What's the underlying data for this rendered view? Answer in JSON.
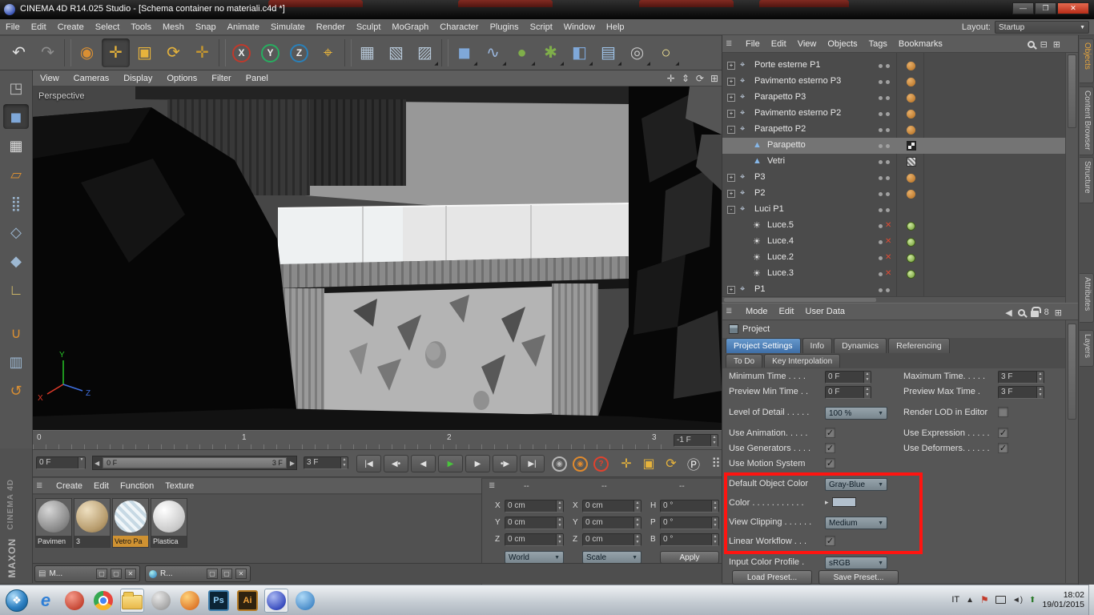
{
  "window": {
    "title": "CINEMA 4D R14.025 Studio - [Schema container no materiali.c4d *]",
    "controls": {
      "minimize": "—",
      "maximize": "❐",
      "close": "✕"
    }
  },
  "background_tabs": {
    "count": 4
  },
  "menu_bar": {
    "items": [
      "File",
      "Edit",
      "Create",
      "Select",
      "Tools",
      "Mesh",
      "Snap",
      "Animate",
      "Simulate",
      "Render",
      "Sculpt",
      "MoGraph",
      "Character",
      "Plugins",
      "Script",
      "Window",
      "Help"
    ],
    "layout_label": "Layout:",
    "layout_value": "Startup"
  },
  "toolbar": {
    "buttons": [
      {
        "name": "undo",
        "glyph": "↶",
        "color": "#e2e2e2"
      },
      {
        "name": "redo",
        "glyph": "↷",
        "color": "#8f8f8f"
      },
      {
        "sep": true
      },
      {
        "name": "live-selection",
        "glyph": "◉",
        "color": "#d98f33"
      },
      {
        "name": "move-tool",
        "glyph": "✛",
        "color": "#e6b33c",
        "pressed": true
      },
      {
        "name": "scale-tool",
        "glyph": "▣",
        "color": "#e6b33c"
      },
      {
        "name": "rotate-tool",
        "glyph": "⟳",
        "color": "#e6b33c"
      },
      {
        "name": "last-used-tool",
        "glyph": "✛",
        "color": "#c9992e"
      },
      {
        "sep": true
      },
      {
        "name": "lock-x-axis",
        "glyph": "X",
        "color": "#efefef",
        "ring": "#c0392b"
      },
      {
        "name": "lock-y-axis",
        "glyph": "Y",
        "color": "#efefef",
        "ring": "#27ae60"
      },
      {
        "name": "lock-z-axis",
        "glyph": "Z",
        "color": "#efefef",
        "ring": "#2980b9"
      },
      {
        "name": "coordinate-system",
        "glyph": "⌖",
        "color": "#e6b33c"
      },
      {
        "sep": true
      },
      {
        "name": "render-view",
        "glyph": "▦",
        "color": "#b5c6d6"
      },
      {
        "name": "render-region",
        "glyph": "▧",
        "color": "#b5c6d6"
      },
      {
        "name": "render-settings",
        "glyph": "▨",
        "color": "#b5c6d6",
        "arrow": true
      },
      {
        "sep": true
      },
      {
        "name": "add-cube",
        "glyph": "◼",
        "color": "#7fa8d9",
        "arrow": true
      },
      {
        "name": "add-spline",
        "glyph": "∿",
        "color": "#9ab6dd",
        "arrow": true
      },
      {
        "name": "add-generator",
        "glyph": "●",
        "color": "#7fae4a",
        "arrow": true
      },
      {
        "name": "add-mograph",
        "glyph": "✱",
        "color": "#7fae4a",
        "arrow": true
      },
      {
        "name": "add-deformer",
        "glyph": "◧",
        "color": "#7fa8d9",
        "arrow": true
      },
      {
        "name": "add-environment",
        "glyph": "▤",
        "color": "#9fc3e8",
        "arrow": true
      },
      {
        "name": "add-camera",
        "glyph": "◎",
        "color": "#c4c4c4",
        "arrow": true
      },
      {
        "name": "add-light",
        "glyph": "○",
        "color": "#f2e394",
        "arrow": true
      }
    ]
  },
  "left_toolbar": {
    "buttons": [
      {
        "name": "make-editable",
        "glyph": "◳",
        "color": "#bdbdbd"
      },
      {
        "name": "model-mode",
        "glyph": "◼",
        "color": "#7fa8d9",
        "pressed": true
      },
      {
        "name": "texture-mode",
        "glyph": "▦",
        "color": "#dcdcdc"
      },
      {
        "name": "texture-axis-mode",
        "glyph": "▱",
        "color": "#d98f33"
      },
      {
        "name": "points-mode",
        "glyph": "⣿",
        "color": "#9db8d2"
      },
      {
        "name": "edges-mode",
        "glyph": "◇",
        "color": "#9db8d2"
      },
      {
        "name": "polygons-mode",
        "glyph": "◆",
        "color": "#9db8d2"
      },
      {
        "name": "axis-mode",
        "glyph": "∟",
        "color": "#d9c06a"
      },
      {
        "name": "snap-toggle",
        "glyph": "∪",
        "color": "#d98f33",
        "gap": true
      },
      {
        "name": "lock-workplane",
        "glyph": "▥",
        "color": "#9db8d2"
      },
      {
        "name": "workplane-tool",
        "glyph": "↺",
        "color": "#d98f33"
      }
    ]
  },
  "viewport": {
    "menus": [
      "View",
      "Cameras",
      "Display",
      "Options",
      "Filter",
      "Panel"
    ],
    "corner_icons": [
      {
        "name": "pan-view-icon",
        "glyph": "✛"
      },
      {
        "name": "zoom-view-icon",
        "glyph": "⇕"
      },
      {
        "name": "rotate-view-icon",
        "glyph": "⟳"
      },
      {
        "name": "toggle-layout-icon",
        "glyph": "⊞"
      }
    ],
    "label": "Perspective",
    "axis_labels": {
      "x": "X",
      "y": "Y",
      "z": "Z"
    }
  },
  "timeline": {
    "ticks": [
      "0",
      "1",
      "2",
      "3"
    ],
    "end_field": "-1 F"
  },
  "transport": {
    "current_frame": "0 F",
    "range_start": "0 F",
    "range_end": "3 F",
    "frame_field": "3 F",
    "buttons": [
      {
        "name": "goto-start",
        "glyph": "|◀"
      },
      {
        "name": "prev-key",
        "glyph": "◀•"
      },
      {
        "name": "prev-frame",
        "glyph": "◀"
      },
      {
        "name": "play",
        "glyph": "▶",
        "color": "#49c53c"
      },
      {
        "name": "next-frame",
        "glyph": "▶"
      },
      {
        "name": "next-key",
        "glyph": "•▶"
      },
      {
        "name": "goto-end",
        "glyph": "▶|"
      }
    ],
    "record_buttons": [
      {
        "name": "record-button",
        "glyph": "◉",
        "color": "#b8b8b8"
      },
      {
        "name": "autokey-button",
        "glyph": "◉",
        "color": "#e08a2e"
      },
      {
        "name": "help-button",
        "glyph": "?",
        "color": "#e0422e"
      }
    ],
    "right_buttons": [
      {
        "name": "move-icon",
        "glyph": "✛",
        "color": "#e6b33c"
      },
      {
        "name": "scale-icon",
        "glyph": "▣",
        "color": "#e6b33c"
      },
      {
        "name": "rotate-icon",
        "glyph": "⟳",
        "color": "#e6b33c"
      },
      {
        "name": "coords-icon",
        "glyph": "Ⓟ",
        "color": "#e8e8e8"
      },
      {
        "name": "grid-icon",
        "glyph": "⠿",
        "color": "#cccccc"
      },
      {
        "name": "panel-icon",
        "glyph": "▤",
        "color": "#5fb3c9"
      }
    ]
  },
  "materials_panel": {
    "menus": [
      "Create",
      "Edit",
      "Function",
      "Texture"
    ],
    "materials": [
      {
        "name": "Pavimen",
        "style": "concrete",
        "selected": false
      },
      {
        "name": "3",
        "style": "tan",
        "selected": false
      },
      {
        "name": "Vetro Pa",
        "style": "glass-stripes",
        "selected": true
      },
      {
        "name": "Plastica",
        "style": "white",
        "selected": false
      }
    ],
    "brand_top": "MAXON",
    "brand_bottom": "CINEMA 4D"
  },
  "coordinates_panel": {
    "headers": [
      "--",
      "--",
      "--"
    ],
    "groups": [
      {
        "rows": [
          {
            "label": "X",
            "value": "0 cm"
          },
          {
            "label": "Y",
            "value": "0 cm"
          },
          {
            "label": "Z",
            "value": "0 cm"
          }
        ],
        "footer": {
          "type": "dropdown",
          "value": "World"
        }
      },
      {
        "rows": [
          {
            "label": "X",
            "value": "0 cm"
          },
          {
            "label": "Y",
            "value": "0 cm"
          },
          {
            "label": "Z",
            "value": "0 cm"
          }
        ],
        "footer": {
          "type": "dropdown",
          "value": "Scale"
        }
      },
      {
        "rows": [
          {
            "label": "H",
            "value": "0 °"
          },
          {
            "label": "P",
            "value": "0 °"
          },
          {
            "label": "B",
            "value": "0 °"
          }
        ],
        "footer": {
          "type": "button",
          "value": "Apply"
        }
      }
    ]
  },
  "object_manager": {
    "menus": [
      "File",
      "Edit",
      "View",
      "Objects",
      "Tags",
      "Bookmarks"
    ],
    "objects": [
      {
        "name": "Porte esterne P1",
        "level": 0,
        "expander": "+",
        "icon": "null",
        "tags": [
          "orange"
        ]
      },
      {
        "name": "Pavimento esterno P3",
        "level": 0,
        "expander": "+",
        "icon": "null",
        "tags": [
          "orange"
        ]
      },
      {
        "name": "Parapetto P3",
        "level": 0,
        "expander": "+",
        "icon": "null",
        "tags": [
          "orange"
        ]
      },
      {
        "name": "Pavimento esterno P2",
        "level": 0,
        "expander": "+",
        "icon": "null",
        "tags": [
          "orange"
        ]
      },
      {
        "name": "Parapetto P2",
        "level": 0,
        "expander": "-",
        "icon": "null",
        "tags": [
          "orange"
        ]
      },
      {
        "name": "Parapetto",
        "level": 1,
        "icon": "polygon",
        "tags": [
          "checker"
        ],
        "selected": true
      },
      {
        "name": "Vetri",
        "level": 1,
        "icon": "polygon",
        "tags": [
          "stripes"
        ]
      },
      {
        "name": "P3",
        "level": 0,
        "expander": "+",
        "icon": "null",
        "tags": [
          "orange"
        ]
      },
      {
        "name": "P2",
        "level": 0,
        "expander": "+",
        "icon": "null",
        "tags": [
          "orange"
        ]
      },
      {
        "name": "Luci P1",
        "level": 0,
        "expander": "-",
        "icon": "null",
        "tags": []
      },
      {
        "name": "Luce.5",
        "level": 1,
        "icon": "light",
        "redx": true,
        "tags": [
          "green"
        ]
      },
      {
        "name": "Luce.4",
        "level": 1,
        "icon": "light",
        "redx": true,
        "tags": [
          "green"
        ]
      },
      {
        "name": "Luce.2",
        "level": 1,
        "icon": "light",
        "redx": true,
        "tags": [
          "green"
        ]
      },
      {
        "name": "Luce.3",
        "level": 1,
        "icon": "light",
        "redx": true,
        "tags": [
          "green"
        ]
      },
      {
        "name": "P1",
        "level": 0,
        "expander": "+",
        "icon": "null",
        "tags": []
      }
    ]
  },
  "attributes_panel": {
    "menus": [
      "Mode",
      "Edit",
      "User Data"
    ],
    "section_title": "Project",
    "tabs_row1": [
      {
        "label": "Project Settings",
        "selected": true
      },
      {
        "label": "Info",
        "selected": false
      },
      {
        "label": "Dynamics",
        "selected": false
      },
      {
        "label": "Referencing",
        "selected": false
      }
    ],
    "tabs_row2": [
      {
        "label": "To Do",
        "selected": false
      },
      {
        "label": "Key Interpolation",
        "selected": false
      }
    ],
    "general_rows": [
      {
        "cols": [
          {
            "label": "Minimum Time . . . .",
            "control": {
              "type": "stepper",
              "value": "0 F"
            }
          },
          {
            "label": "Maximum Time. . . . .",
            "control": {
              "type": "stepper",
              "value": "3 F"
            }
          }
        ]
      },
      {
        "cols": [
          {
            "label": "Preview Min Time . .",
            "control": {
              "type": "stepper",
              "value": "0 F"
            }
          },
          {
            "label": "Preview Max Time .",
            "control": {
              "type": "stepper",
              "value": "3 F"
            }
          }
        ]
      },
      {
        "gap": true
      },
      {
        "cols": [
          {
            "label": "Level of Detail . . . . .",
            "control": {
              "type": "dropdown",
              "value": "100 %"
            }
          },
          {
            "label": "Render LOD in Editor",
            "control": {
              "type": "checkbox",
              "checked": false
            }
          }
        ]
      },
      {
        "gap": true
      },
      {
        "cols": [
          {
            "label": "Use Animation. . . . .",
            "control": {
              "type": "checkbox",
              "checked": true
            }
          },
          {
            "label": "Use Expression . . . . .",
            "control": {
              "type": "checkbox",
              "checked": true
            }
          }
        ]
      },
      {
        "cols": [
          {
            "label": "Use Generators . . . .",
            "control": {
              "type": "checkbox",
              "checked": true
            }
          },
          {
            "label": "Use Deformers. . . . . .",
            "control": {
              "type": "checkbox",
              "checked": true
            }
          }
        ]
      },
      {
        "cols": [
          {
            "label": "Use Motion System",
            "control": {
              "type": "checkbox",
              "checked": true
            }
          }
        ]
      }
    ],
    "highlighted_rows": [
      {
        "cols": [
          {
            "label": "Default Object Color",
            "control": {
              "type": "dropdown",
              "value": "Gray-Blue"
            }
          }
        ]
      },
      {
        "cols": [
          {
            "label": "Color . . . . . . . . . . .",
            "control": {
              "type": "swatch",
              "color": "#b2c0cd"
            }
          }
        ]
      },
      {
        "cols": [
          {
            "label": "View Clipping . . . . . .",
            "control": {
              "type": "dropdown",
              "value": "Medium"
            }
          }
        ]
      },
      {
        "cols": [
          {
            "label": "Linear Workflow . . .",
            "control": {
              "type": "checkbox",
              "checked": true
            }
          }
        ]
      }
    ],
    "footer_rows": [
      {
        "cols": [
          {
            "label": "Input Color Profile .",
            "control": {
              "type": "dropdown",
              "value": "sRGB"
            }
          }
        ]
      }
    ],
    "preset_buttons": [
      "Load Preset...",
      "Save Preset..."
    ],
    "highlight_color": "#ff1410"
  },
  "side_tabs": [
    {
      "label": "Objects",
      "active": true
    },
    {
      "label": "Content Browser",
      "active": false
    },
    {
      "label": "Structure",
      "active": false
    },
    {
      "label": "Attributes",
      "active": false
    },
    {
      "label": "Layers",
      "active": false
    }
  ],
  "minimized_panels": [
    {
      "label": "M...",
      "icon": "materials"
    },
    {
      "label": "R...",
      "icon": "app"
    }
  ],
  "taskbar": {
    "icons": [
      {
        "name": "start-button",
        "style": "start",
        "glyph": "❖"
      },
      {
        "name": "internet-explorer-icon",
        "style": "ie",
        "glyph": "e"
      },
      {
        "name": "media-player-icon",
        "style": "red-ball"
      },
      {
        "name": "chrome-icon",
        "style": "chrome"
      },
      {
        "name": "explorer-icon",
        "style": "folder",
        "active": true
      },
      {
        "name": "app-gray-icon",
        "style": "gray-ball"
      },
      {
        "name": "firefox-icon",
        "style": "orange-ball"
      },
      {
        "name": "photoshop-icon",
        "style": "ps",
        "glyph": "Ps"
      },
      {
        "name": "illustrator-icon",
        "style": "ai",
        "glyph": "Ai"
      },
      {
        "name": "cinema4d-icon",
        "style": "c4d-ball",
        "active": true
      },
      {
        "name": "app-blue-icon",
        "style": "blue-ball"
      }
    ],
    "tray": {
      "language": "IT",
      "expand": "▲",
      "time": "18:02",
      "date": "19/01/2015"
    }
  }
}
